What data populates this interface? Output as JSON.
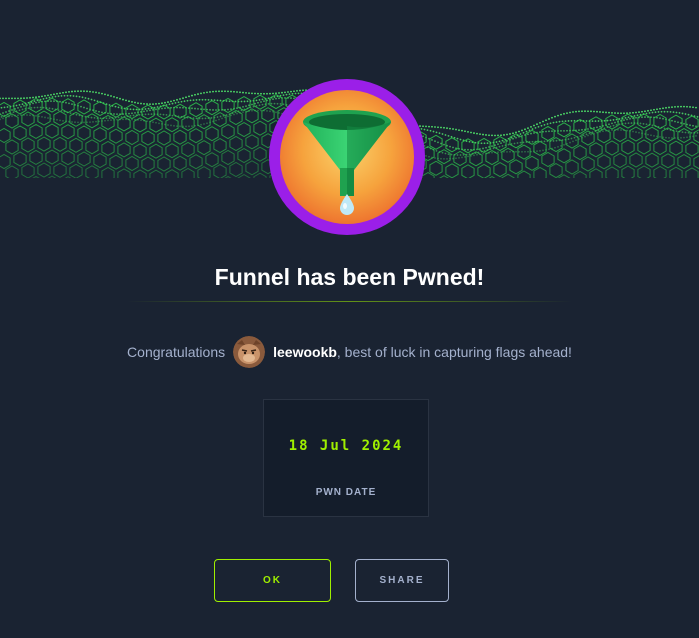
{
  "machine": {
    "name": "Funnel"
  },
  "header": {
    "title": "Funnel has been Pwned!"
  },
  "congrats": {
    "prefix": "Congratulations",
    "username": "leewookb",
    "suffix": ", best of luck in capturing flags ahead!"
  },
  "pwn": {
    "date": "18 Jul 2024",
    "label": "PWN DATE"
  },
  "buttons": {
    "ok_label": "OK",
    "share_label": "SHARE"
  },
  "colors": {
    "background": "#1a2332",
    "accent": "#9fef00",
    "badge_ring": "#9b1fe8",
    "badge_inner": "#f7a13a",
    "muted_text": "#a4b1cd"
  },
  "icons": {
    "badge": "funnel-icon",
    "avatar": "user-avatar"
  }
}
